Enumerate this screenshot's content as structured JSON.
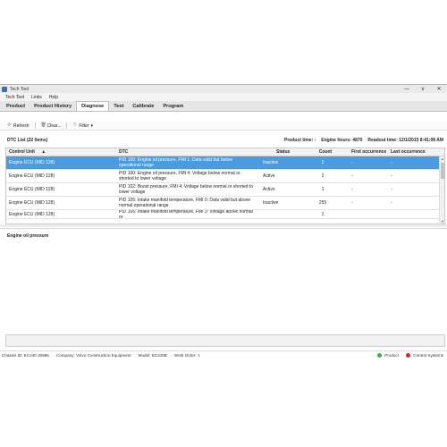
{
  "window": {
    "title": "Tech Tool",
    "btn_min": "—",
    "btn_restore": "∨",
    "btn_close": "✕"
  },
  "menu": [
    "Tech Tool",
    "Links",
    "Help"
  ],
  "tabs": [
    "Product",
    "Product History",
    "Diagnose",
    "Test",
    "Calibrate",
    "Program"
  ],
  "active_tab": "Diagnose",
  "toolbar": {
    "refresh": "Refresh",
    "clear": "Clear...",
    "filter": "Filter"
  },
  "list": {
    "title": "DTC List (22 Items)",
    "product_time_label": "Product time: -",
    "engine_hours": "Engine hours: 4870",
    "readout_time": "Readout time: 12/1/2015 8:41:08 AM"
  },
  "table": {
    "headers": [
      "Control Unit",
      "DTC",
      "Status",
      "Count",
      "First occurrence",
      "Last occurrence"
    ],
    "sort_indicator": "▲",
    "rows": [
      {
        "unit": "Engine ECU (MID 128)",
        "dtc": "PID 100: Engine oil pressure, FMI 1: Data valid but below operational range",
        "status": "Inactive",
        "count": "2",
        "first": "-",
        "last": "-"
      },
      {
        "unit": "Engine ECU (MID 128)",
        "dtc": "PID 100: Engine oil pressure, FMI 4: Voltage below normal or shorted to lower voltage",
        "status": "Active",
        "count": "2",
        "first": "-",
        "last": "-"
      },
      {
        "unit": "Engine ECU (MID 128)",
        "dtc": "PID 102: Boost pressure, FMI 4: Voltage below normal or shorted to lower voltage",
        "status": "Active",
        "count": "1",
        "first": "-",
        "last": "-"
      },
      {
        "unit": "Engine ECU (MID 128)",
        "dtc": "PID 105: Intake manifold temperature, FMI 0: Data valid but above normal operational range",
        "status": "Inactive",
        "count": "255",
        "first": "-",
        "last": "-"
      },
      {
        "unit": "Engine ECU (MID 128)",
        "dtc": "PID 105: Intake manifold temperature, FMI 3: Voltage above normal or",
        "status": "",
        "count": "1",
        "first": "",
        "last": ""
      }
    ]
  },
  "detail": {
    "title": "Engine oil pressure"
  },
  "status": {
    "chassis": "Chassis ID: EC240 30586",
    "company": "Company: Volvo Construction Equipment",
    "model": "Model: EC240B",
    "work_order": "Work Order: 1",
    "product": "Product",
    "control_systems": "Control Systems",
    "product_color": "#3cb043",
    "cs_color": "#d62828"
  },
  "colors": {
    "selected_row": "#4a9be0"
  }
}
